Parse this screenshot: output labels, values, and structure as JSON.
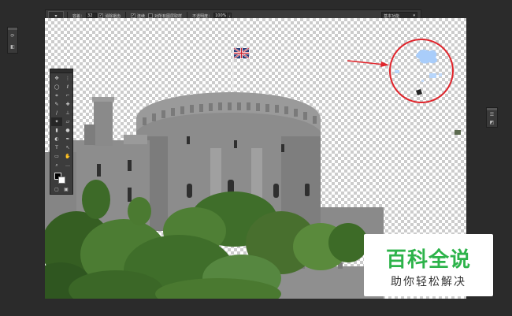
{
  "options_bar": {
    "tool_icon": "eraser-tool-icon",
    "size_label": "容差：",
    "size_value": "32",
    "antialias_label": "消除锯齿",
    "contiguous_label": "连续",
    "sample_all_label": "对所有图层取样",
    "opacity_label": "不透明度：",
    "opacity_value": "100%",
    "workspace_label": "基本功能"
  },
  "left_panel": {
    "icons": [
      "history-icon",
      "properties-icon"
    ]
  },
  "right_panel": {
    "icons": [
      "layers-icon",
      "channels-icon"
    ]
  },
  "tools": {
    "items": [
      "move-icon",
      "artboard-icon",
      "marquee-icon",
      "lasso-icon",
      "quick-select-icon",
      "crop-icon",
      "eyedropper-icon",
      "healing-brush-icon",
      "brush-icon",
      "clone-stamp-icon",
      "history-brush-icon",
      "eraser-icon",
      "gradient-icon",
      "blur-icon",
      "dodge-icon",
      "pen-icon",
      "type-icon",
      "path-select-icon",
      "shape-icon",
      "hand-icon",
      "zoom-icon",
      "more-icon"
    ],
    "foreground_color": "#000000",
    "background_color": "#ffffff"
  },
  "watermark": {
    "line1": "百科全说",
    "line2": "助你轻松解决",
    "color": "#2db34a"
  },
  "annotation_color": "#e0242b"
}
